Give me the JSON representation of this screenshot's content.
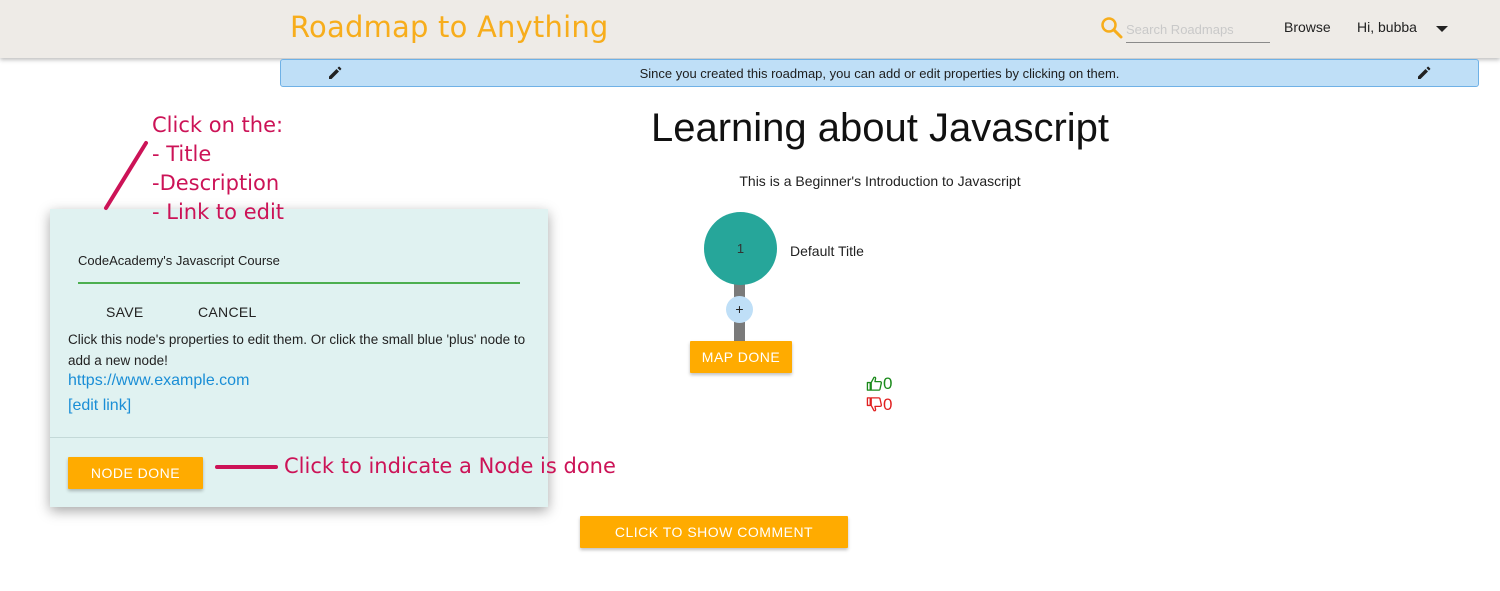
{
  "header": {
    "app_title": "Roadmap to Anything",
    "search_placeholder": "Search Roadmaps",
    "browse_label": "Browse",
    "user_label": "Hi, bubba",
    "accent_color": "#f7ad1c"
  },
  "banner": {
    "text": "Since you created this roadmap, you can add or edit properties by clicking on them."
  },
  "roadmap": {
    "title": "Learning about Javascript",
    "description": "This is a Beginner's Introduction to Javascript",
    "node_number": "1",
    "node_title": "Default Title",
    "add_node_label": "+",
    "map_done_label": "MAP DONE",
    "upvotes": "0",
    "downvotes": "0",
    "show_comments_label": "CLICK TO SHOW COMMENT SECTION",
    "node_color": "#26a69a"
  },
  "node_panel": {
    "field_value": "CodeAcademy's Javascript Course",
    "save_label": "SAVE",
    "cancel_label": "CANCEL",
    "help_text": "Click this node's properties to edit them. Or click the small blue 'plus' node to add a new node!",
    "link_text": "https://www.example.com",
    "edit_link_label": "[edit link]",
    "node_done_label": "NODE DONE"
  },
  "annotations": {
    "lines": [
      "Click on the:",
      "- Title",
      "-Description",
      "- Link to edit"
    ],
    "node_done_hint": "Click to indicate a Node is done",
    "color": "#cc1357"
  }
}
